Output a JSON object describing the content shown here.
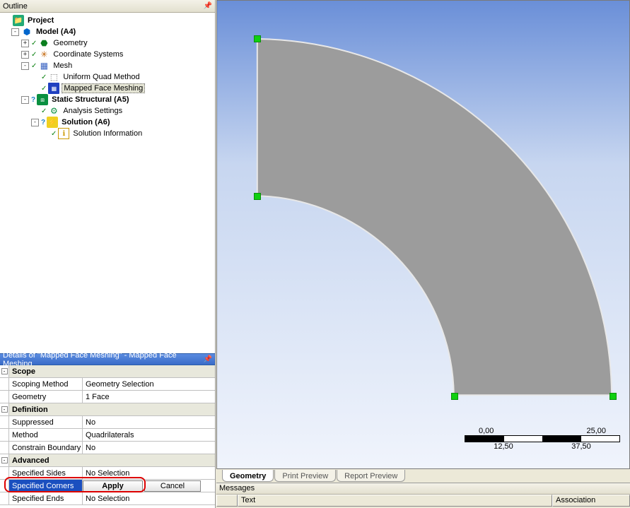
{
  "outline": {
    "title": "Outline",
    "tree": {
      "project": "Project",
      "model": "Model (A4)",
      "geometry": "Geometry",
      "coordinate_systems": "Coordinate Systems",
      "mesh": "Mesh",
      "uniform_quad": "Uniform Quad Method",
      "mapped_face": "Mapped Face Meshing",
      "static_structural": "Static Structural (A5)",
      "analysis_settings": "Analysis Settings",
      "solution": "Solution (A6)",
      "solution_info": "Solution Information"
    }
  },
  "details": {
    "header": "Details of \"Mapped Face Meshing\" - Mapped Face Meshing",
    "sections": {
      "scope": "Scope",
      "definition": "Definition",
      "advanced": "Advanced"
    },
    "rows": {
      "scoping_method": {
        "name": "Scoping Method",
        "value": "Geometry Selection"
      },
      "geometry": {
        "name": "Geometry",
        "value": "1 Face"
      },
      "suppressed": {
        "name": "Suppressed",
        "value": "No"
      },
      "method": {
        "name": "Method",
        "value": "Quadrilaterals"
      },
      "constrain_boundary": {
        "name": "Constrain Boundary",
        "value": "No"
      },
      "specified_sides": {
        "name": "Specified Sides",
        "value": "No Selection"
      },
      "specified_corners": {
        "name": "Specified Corners",
        "apply": "Apply",
        "cancel": "Cancel"
      },
      "specified_ends": {
        "name": "Specified Ends",
        "value": "No Selection"
      }
    }
  },
  "viewport": {
    "ruler": {
      "t1": "0,00",
      "t2": "25,00",
      "b1": "12,50",
      "b2": "37,50"
    }
  },
  "tabs": {
    "geometry": "Geometry",
    "print_preview": "Print Preview",
    "report_preview": "Report Preview"
  },
  "messages": {
    "header": "Messages",
    "col_text": "Text",
    "col_assoc": "Association"
  }
}
